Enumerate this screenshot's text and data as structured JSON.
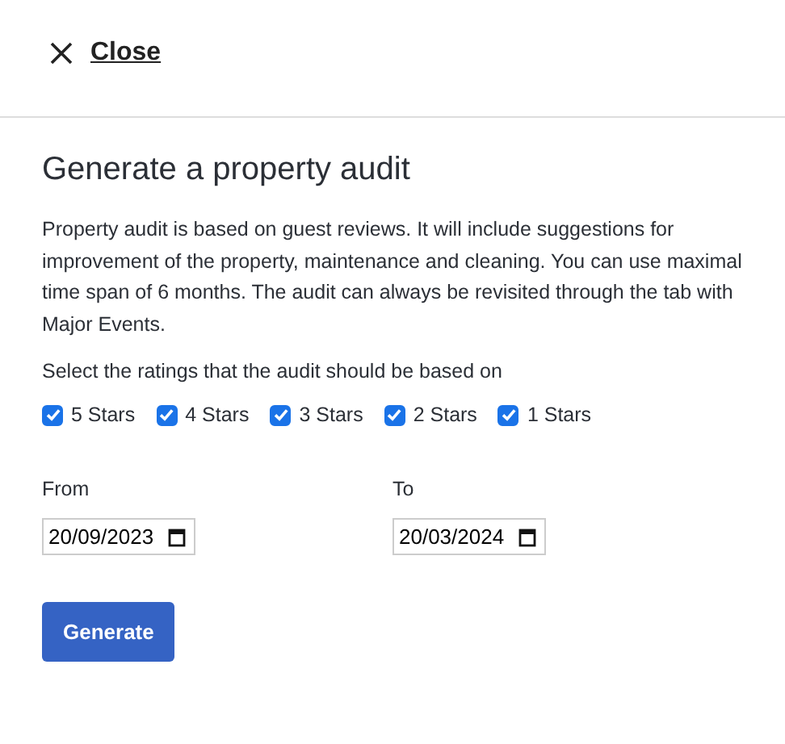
{
  "close_link": "Close",
  "title": "Generate a property audit",
  "description": "Property audit is based on guest reviews. It will include suggestions for improvement of the property, maintenance and cleaning. You can use maximal time span of 6 months. The audit can always be revisited through the tab with Major Events.",
  "ratings_prompt": "Select the ratings that the audit should be based on",
  "ratings": [
    {
      "label": "5 Stars",
      "checked": true
    },
    {
      "label": "4 Stars",
      "checked": true
    },
    {
      "label": "3 Stars",
      "checked": true
    },
    {
      "label": "2 Stars",
      "checked": true
    },
    {
      "label": "1 Stars",
      "checked": true
    }
  ],
  "dates": [
    {
      "label": "From",
      "value": "20/09/2023"
    },
    {
      "label": "To",
      "value": "20/03/2024"
    }
  ],
  "button": "Generate"
}
